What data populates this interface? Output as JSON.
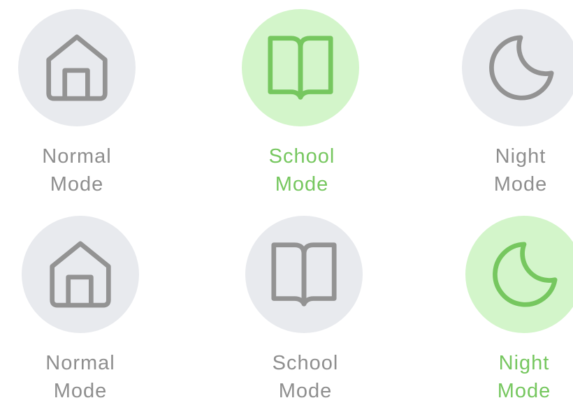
{
  "colors": {
    "inactive_bg": "#e8eaee",
    "inactive_fg": "#939393",
    "active_bg": "#d3f5ca",
    "active_fg": "#76c75f"
  },
  "rows": [
    {
      "modes": [
        {
          "icon": "home-icon",
          "line1": "Normal",
          "line2": "Mode",
          "selected": false
        },
        {
          "icon": "book-icon",
          "line1": "School",
          "line2": "Mode",
          "selected": true
        },
        {
          "icon": "moon-icon",
          "line1": "Night",
          "line2": "Mode",
          "selected": false
        }
      ]
    },
    {
      "modes": [
        {
          "icon": "home-icon",
          "line1": "Normal",
          "line2": "Mode",
          "selected": false
        },
        {
          "icon": "book-icon",
          "line1": "School",
          "line2": "Mode",
          "selected": false
        },
        {
          "icon": "moon-icon",
          "line1": "Night",
          "line2": "Mode",
          "selected": true
        }
      ]
    }
  ]
}
